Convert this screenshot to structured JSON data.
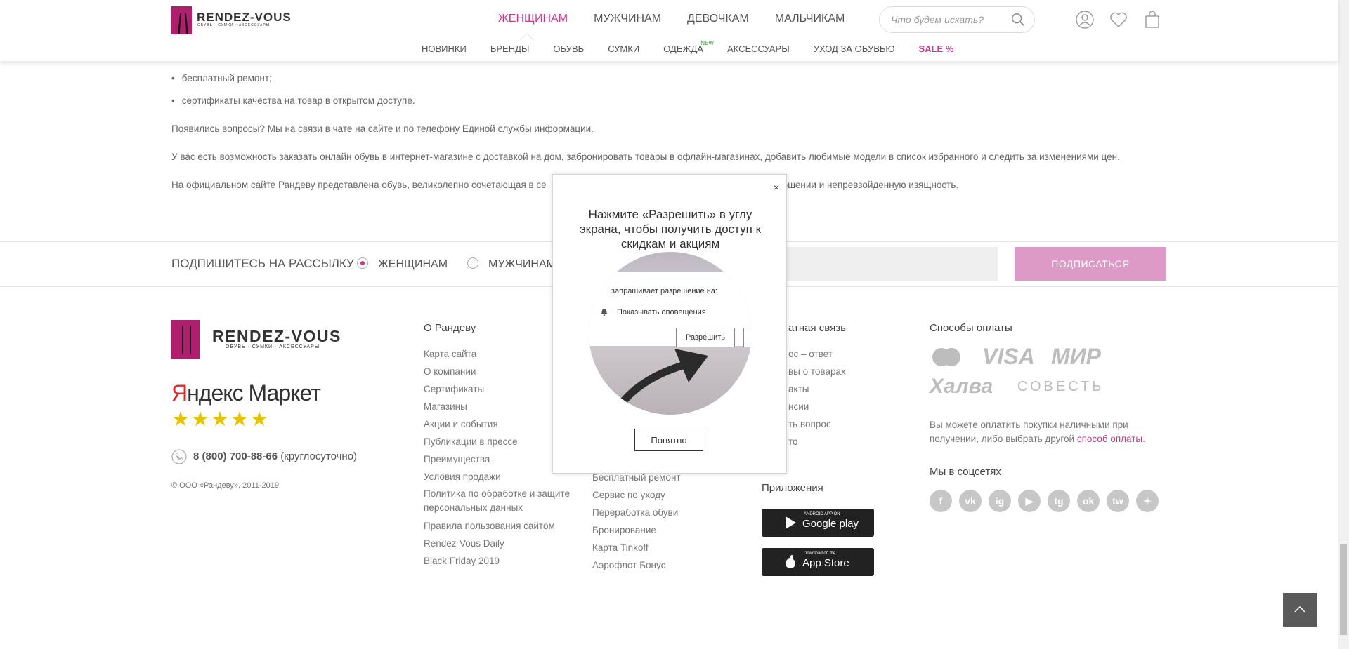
{
  "header": {
    "logo_text": "RENDEZ-VOUS",
    "logo_sub": "ОБУВЬ · СУМКИ · АКСЕССУАРЫ",
    "main_nav": [
      "ЖЕНЩИНАМ",
      "МУЖЧИНАМ",
      "ДЕВОЧКАМ",
      "МАЛЬЧИКАМ"
    ],
    "search_placeholder": "Что будем искать?",
    "sub_nav": [
      "НОВИНКИ",
      "БРЕНДЫ",
      "ОБУВЬ",
      "СУМКИ",
      "ОДЕЖДА",
      "АКСЕССУАРЫ",
      "УХОД ЗА ОБУВЬЮ",
      "SALE %"
    ],
    "new_badge": "NEW"
  },
  "content": {
    "bullets": [
      "бесплатный ремонт;",
      "сертификаты качества на товар в открытом доступе."
    ],
    "paragraphs": [
      "Появились вопросы? Мы на связи в чате на сайте и по телефону Единой службы информации.",
      "У вас есть возможность заказать онлайн обувь в интернет-магазине с доставкой на дом, забронировать товары в офлайн-магазинах, добавить любимые модели в список избранного и следить за изменениями цен.",
      "На официальном сайте Рандеву представлена обувь, великолепно сочетающая в се",
      "при ношении и непревзойденную изящность."
    ]
  },
  "subscribe": {
    "title": "ПОДПИШИТЕСЬ НА РАССЫЛКУ",
    "options": [
      "ЖЕНЩИНАМ",
      "МУЖЧИНАМ"
    ],
    "selected": "ЖЕНЩИНАМ",
    "button": "ПОДПИСАТЬСЯ"
  },
  "footer": {
    "logo_text": "RENDEZ-VOUS",
    "logo_sub": "ОБУВЬ · СУМКИ · АКСЕССУАРЫ",
    "ym_first": "Я",
    "ym_rest": "ндекс Маркет",
    "stars": "★★★★★",
    "phone_number": "8 (800) 700-88-66",
    "phone_note": "(круглосуточно)",
    "copyright": "© ООО «Рандеву», 2011-2019",
    "col1_title": "О Рандеву",
    "col1_links": [
      "Карта сайта",
      "О компании",
      "Сертификаты",
      "Магазины",
      "Акции и события",
      "Публикации в прессе",
      "Преимущества",
      "Условия продажи",
      "Политика по обработке и защите персональных данных",
      "Правила пользования сайтом",
      "Rendez-Vous Daily",
      "Black Friday 2019"
    ],
    "col2_links": [
      "Бесплатный ремонт",
      "Сервис по уходу",
      "Переработка обуви",
      "Бронирование",
      "Карта Tinkoff",
      "Аэрофлот Бонус"
    ],
    "col3_title": "атная связь",
    "col3_links": [
      "ос – ответ",
      "вы о товарах",
      "акты",
      "нсии",
      "ть вопрос",
      "то"
    ],
    "apps_title": "Приложения",
    "google_small": "ANDROID APP ON",
    "google_big": "Google play",
    "apple_small": "Download on the",
    "apple_big": "App Store",
    "pay_title": "Способы оплаты",
    "pay_logos": [
      "VISA",
      "МИР",
      "Халва",
      "СОВЕСТЬ"
    ],
    "pay_text": "Вы можете оплатить покупки наличными при получении, либо выбрать другой",
    "pay_link": "способ оплаты",
    "social_title": "Мы в соцсетях",
    "social": [
      "f",
      "vk",
      "ig",
      "▶",
      "tg",
      "ok",
      "tw",
      "✦"
    ]
  },
  "modal": {
    "close": "×",
    "text": "Нажмите «Разрешить» в углу экрана, чтобы получить доступ к скидкам и акциям",
    "perm_question": "запрашивает разрешение на:",
    "perm_show": "Показывать оповещения",
    "perm_allow": "Разрешить",
    "ok": "Понятно"
  },
  "colors": {
    "accent": "#c8398d",
    "subscribe_button": "#de9ac6",
    "logo": "#b01e6e"
  }
}
